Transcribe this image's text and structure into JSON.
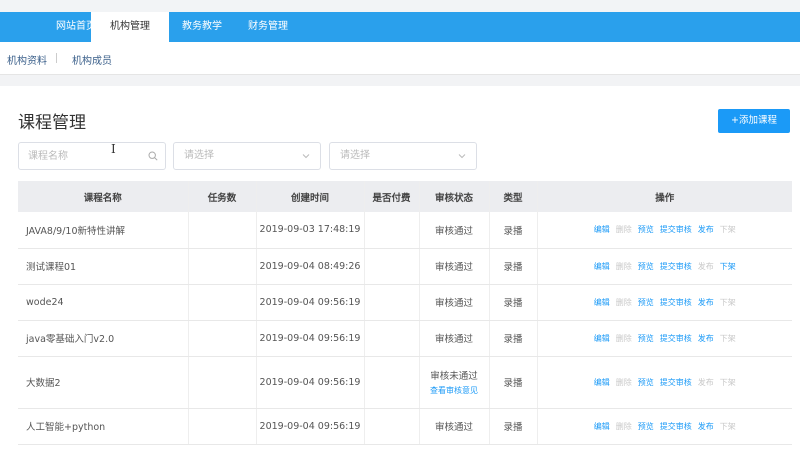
{
  "topnav": {
    "tabs": [
      "网站首页",
      "机构管理",
      "教务教学",
      "财务管理"
    ]
  },
  "subnav": {
    "items": [
      "机构资料",
      "机构成员"
    ]
  },
  "page": {
    "title": "课程管理",
    "add_label": "+添加课程",
    "search_placeholder": "课程名称",
    "select1": "请选择",
    "select2": "请选择"
  },
  "table": {
    "headers": [
      "课程名称",
      "任务数",
      "创建时间",
      "是否付费",
      "审核状态",
      "类型",
      "操作"
    ],
    "rows": [
      {
        "name": "JAVA8/9/10新特性讲解",
        "tasks": "",
        "created": "2019-09-03 17:48:19",
        "paid": "",
        "status": "审核通过",
        "type": "录播"
      },
      {
        "name": "测试课程01",
        "tasks": "",
        "created": "2019-09-04 08:49:26",
        "paid": "",
        "status": "审核通过",
        "type": "录播"
      },
      {
        "name": "wode24",
        "tasks": "",
        "created": "2019-09-04 09:56:19",
        "paid": "",
        "status": "审核通过",
        "type": "录播"
      },
      {
        "name": "java零基础入门v2.0",
        "tasks": "",
        "created": "2019-09-04 09:56:19",
        "paid": "",
        "status": "审核通过",
        "type": "录播"
      },
      {
        "name": "大数据2",
        "tasks": "",
        "created": "2019-09-04 09:56:19",
        "paid": "",
        "status": "审核未通过",
        "review_link": "查看审核意见",
        "type": "录播"
      },
      {
        "name": "人工智能+python",
        "tasks": "",
        "created": "2019-09-04 09:56:19",
        "paid": "",
        "status": "审核通过",
        "type": "录播"
      }
    ],
    "ops": [
      "编辑",
      "删除",
      "预览",
      "提交审核",
      "发布",
      "下架"
    ]
  },
  "colors": {
    "primary": "#1b9af7",
    "nav": "#2aa0ec",
    "disabled": "#c8c8c8"
  }
}
